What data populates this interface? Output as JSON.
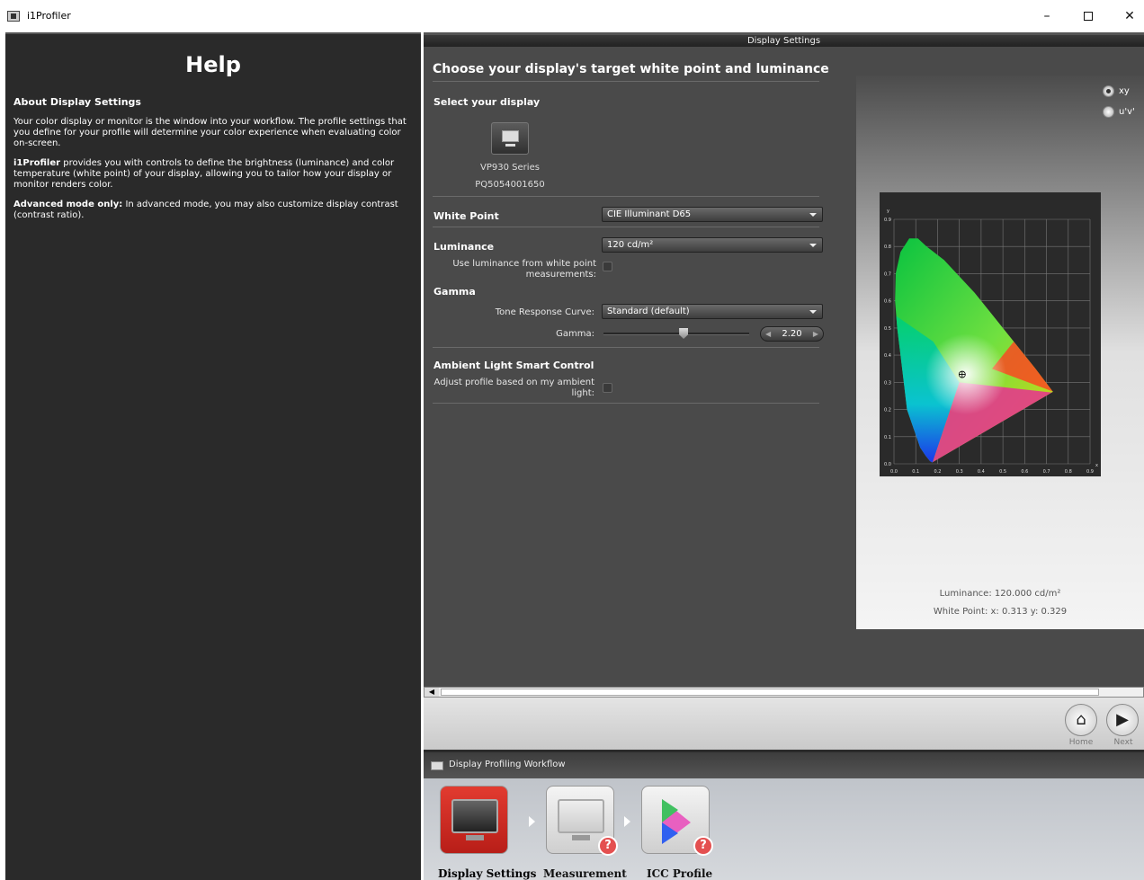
{
  "window": {
    "title": "i1Profiler",
    "minimize": "–",
    "close": "✕"
  },
  "help": {
    "title": "Help",
    "heading": "About Display Settings",
    "p1": "Your color display or monitor is the window into your workflow. The profile settings that you define for your profile will determine your color experience when evaluating color on-screen.",
    "p2_bold": "i1Profiler",
    "p2": " provides you with controls to define the brightness (luminance) and color temperature (white point) of your display, allowing you to tailor how your display or monitor renders color.",
    "p3_bold": "Advanced mode only:",
    "p3": " In advanced mode, you may also customize display contrast (contrast ratio)."
  },
  "main": {
    "header": "Display Settings",
    "title": "Choose your display's target white point and luminance",
    "select_display": "Select your display",
    "display_model": "VP930 Series",
    "display_serial": "PQ5054001650",
    "white_point_label": "White Point",
    "white_point_value": "CIE Illuminant D65",
    "luminance_label": "Luminance",
    "luminance_value": "120 cd/m²",
    "use_luminance_label": "Use luminance from white point measurements:",
    "gamma_section": "Gamma",
    "tone_curve_label": "Tone Response Curve:",
    "tone_curve_value": "Standard (default)",
    "gamma_label": "Gamma:",
    "gamma_value": "2.20",
    "gamma_level": 0.55,
    "ambient_section": "Ambient Light Smart Control",
    "ambient_label": "Adjust profile based on my ambient light:"
  },
  "chart": {
    "radio_xy": "xy",
    "radio_uv": "u'v'",
    "selected": "xy",
    "luminance_info": "Luminance: 120.000 cd/m²",
    "whitepoint_info": "White Point: x: 0.313  y: 0.329",
    "x_axis_label": "x",
    "y_axis_label": "y"
  },
  "chart_data": {
    "type": "scatter",
    "title": "",
    "xlabel": "x",
    "ylabel": "y",
    "xlim": [
      0,
      0.9
    ],
    "ylim": [
      0,
      0.9
    ],
    "x_ticks": [
      "0.0",
      "0.1",
      "0.2",
      "0.3",
      "0.4",
      "0.5",
      "0.6",
      "0.7",
      "0.8",
      "0.9"
    ],
    "y_ticks": [
      "0.0",
      "0.1",
      "0.2",
      "0.3",
      "0.4",
      "0.5",
      "0.6",
      "0.7",
      "0.8",
      "0.9"
    ],
    "series": [
      {
        "x": [
          0.313
        ],
        "y": [
          0.329
        ]
      }
    ]
  },
  "nav": {
    "home": "Home",
    "next": "Next"
  },
  "workflow": {
    "header": "Display Profiling Workflow",
    "steps": [
      {
        "label": "Display Settings"
      },
      {
        "label": "Measurement"
      },
      {
        "label": "ICC Profile"
      }
    ]
  }
}
